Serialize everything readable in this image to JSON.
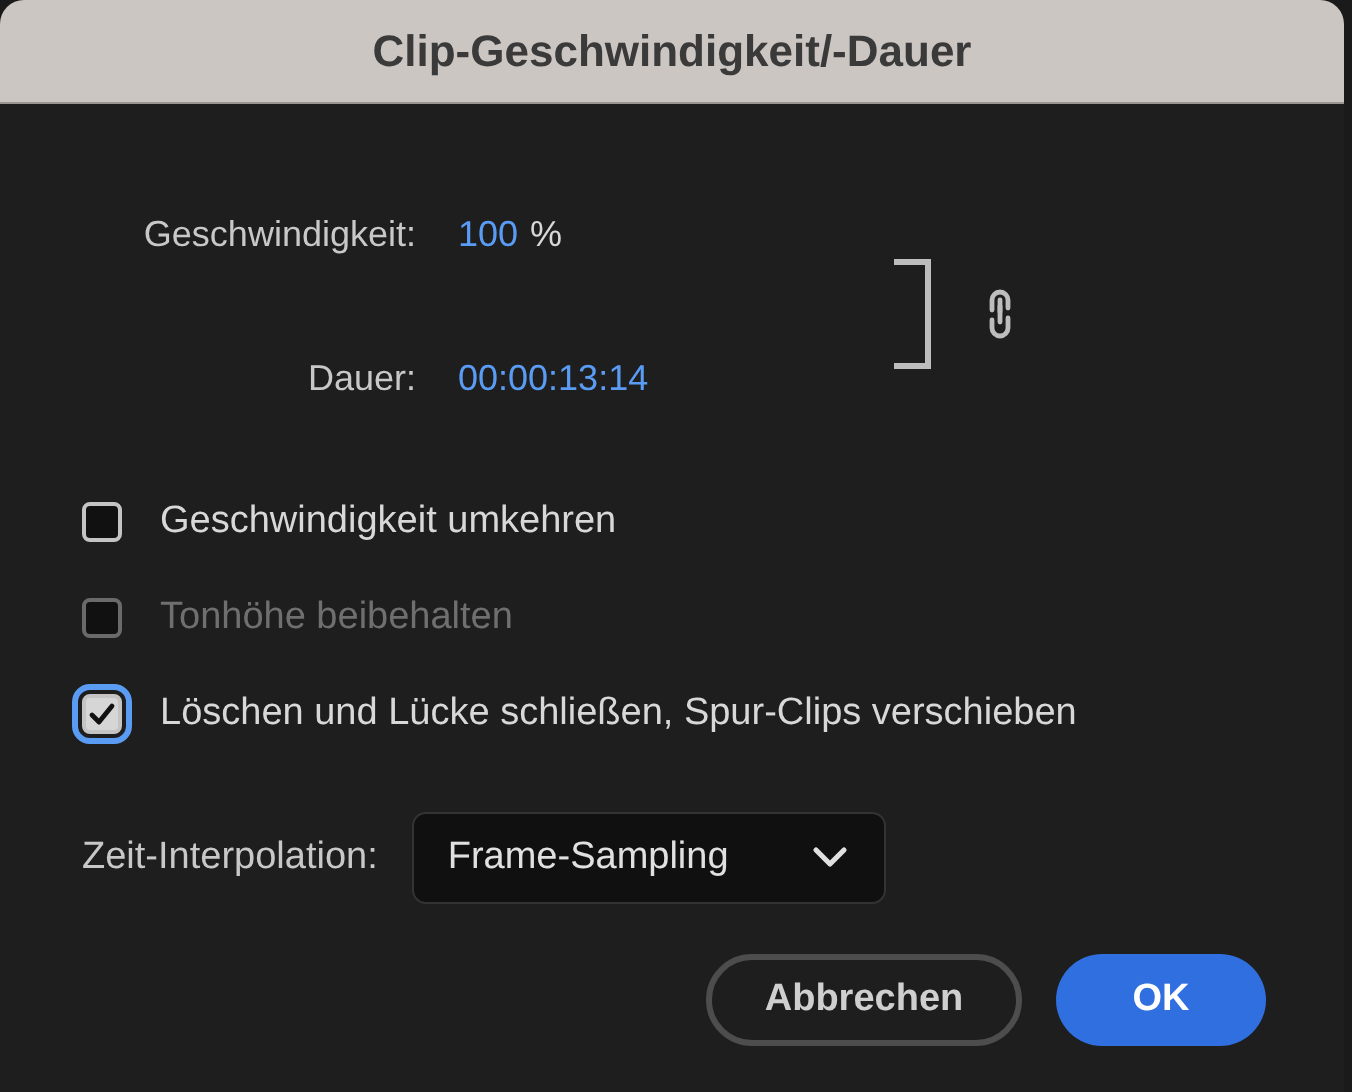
{
  "window": {
    "title": "Clip-Geschwindigkeit/-Dauer"
  },
  "speed": {
    "label": "Geschwindigkeit:",
    "value": "100",
    "unit": "%"
  },
  "duration": {
    "label": "Dauer:",
    "value": "00:00:13:14"
  },
  "link": {
    "linked": true
  },
  "checkboxes": [
    {
      "label": "Geschwindigkeit umkehren",
      "checked": false,
      "disabled": false,
      "focused": false
    },
    {
      "label": "Tonhöhe beibehalten",
      "checked": false,
      "disabled": true,
      "focused": false
    },
    {
      "label": "Löschen und Lücke schließen, Spur-Clips verschieben",
      "checked": true,
      "disabled": false,
      "focused": true
    }
  ],
  "interpolation": {
    "label": "Zeit-Interpolation:",
    "value": "Frame-Sampling"
  },
  "buttons": [
    {
      "label": "Abbrechen",
      "kind": "secondary"
    },
    {
      "label": "OK",
      "kind": "primary"
    }
  ]
}
